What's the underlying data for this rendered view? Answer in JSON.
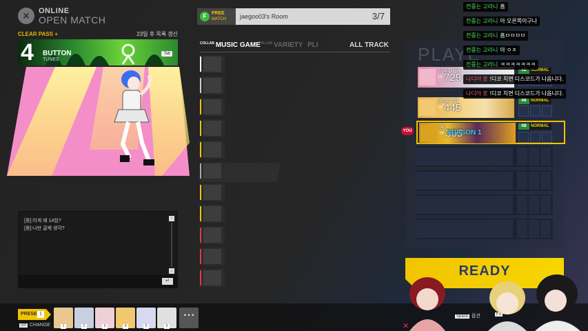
{
  "header": {
    "line1": "ONLINE",
    "line2": "OPEN MATCH",
    "logo": "x-logo-icon"
  },
  "song": {
    "clear_pass": "CLEAR PASS +",
    "update_notice": "23일 후 목록 갱신",
    "button_count": "4",
    "button_label": "BUTTON",
    "button_sub": "TUNES",
    "tab_hint": "Tab"
  },
  "chat": {
    "messages": [
      "[몽]:이게 왜 14임?",
      "[몽]:나만 굴케 생각?"
    ],
    "scroll_up": "↑",
    "scroll_down": "↓",
    "enter": "↵"
  },
  "room": {
    "free_line1": "FREE",
    "free_line2": "MATCH",
    "free_icon": "F",
    "name": "jaegoo03's Room",
    "count": "3/7"
  },
  "categories": {
    "collab1": "COLLAB",
    "music_game": "MUSIC GAME",
    "collab2": "COLLAB",
    "variety": "VARIETY",
    "pli": "PLI",
    "all_track": "ALL TRACK"
  },
  "song_list_stripes": [
    "#ffffff",
    "#cccccc",
    "#f1c400",
    "#f1c400",
    "#f1c400",
    "#aaaaaa",
    "#f1c400",
    "#f1c400",
    "#e0384a",
    "#e0384a",
    "#e0384a"
  ],
  "panel": {
    "title": "PLAYE"
  },
  "players": [
    {
      "name": "TAETTHA",
      "lv_label": "LV",
      "level": "729",
      "buttons": "4B",
      "difficulty": "NORMAL"
    },
    {
      "name": "jaegoo03",
      "lv_label": "LV",
      "level": "445",
      "buttons": "4B",
      "difficulty": "NORMAL"
    },
    {
      "name": "몽",
      "lv_label": "LV",
      "level": "365",
      "buttons": "4B",
      "difficulty": "NORMAL",
      "you": "YOU",
      "banner_text": "SEASON 1"
    }
  ],
  "ready": {
    "label": "READY"
  },
  "overlay_chat": [
    {
      "name": "전중는 고라니",
      "msg": "흠",
      "bot": false
    },
    {
      "name": "전중는 고라니",
      "msg": "아 오른쪽이구나",
      "bot": false
    },
    {
      "name": "전중는 고라니",
      "msg": "흠ㅁㅁㅁㅁ",
      "bot": false
    },
    {
      "name": "전중는 고라니",
      "msg": "아 ㅇㅈ",
      "bot": false
    },
    {
      "name": "전중는 고라니",
      "msg": "ㅋㅋㅋㅋㅋㅋㅋ",
      "bot": false
    },
    {
      "name": "나디아 봇",
      "msg": "!디코 치면 디스코드가 나옵니다.",
      "bot": true
    },
    {
      "name": "나디아 봇",
      "msg": "!디코 치면 디스코드가 나옵니다.",
      "bot": true
    }
  ],
  "bottom": {
    "preset_label": "PRESET",
    "preset_num": "1",
    "change_key": "ctrl",
    "change_label": "CHANGE",
    "preset_slots": [
      "1",
      "2",
      "3",
      "4",
      "5",
      "6"
    ],
    "more": "• • •",
    "space_key": "Space",
    "space_label": "옵션",
    "f1_key": "F1",
    "x_icon": "✕"
  },
  "colors": {
    "accent": "#f1c400",
    "you": "#c8102e",
    "chat_name": "#55e35a",
    "bot_name": "#f05a64",
    "ready_text": "#2b3a6b"
  }
}
